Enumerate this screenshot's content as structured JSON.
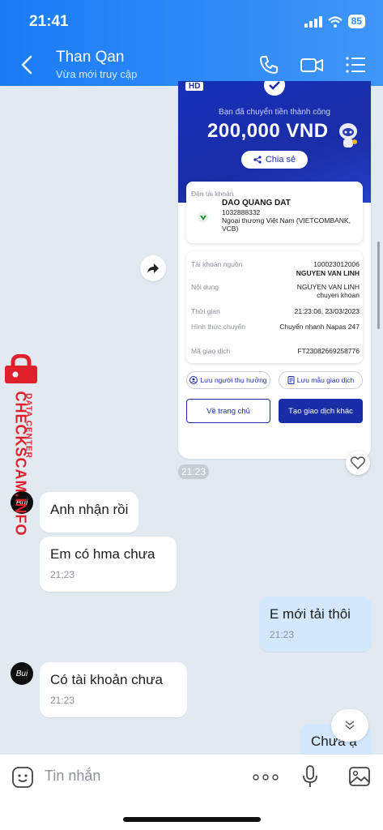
{
  "status": {
    "time": "21:41",
    "battery": "85"
  },
  "header": {
    "name": "Than Qan",
    "subtitle": "Vừa mới truy cập"
  },
  "receipt": {
    "badge": "HD",
    "success_text": "Bạn đã chuyển tiền thành công",
    "amount": "200,000 VND",
    "share": "Chia sẻ",
    "to_label": "Đến tài khoản",
    "to_name": "DAO QUANG DAT",
    "to_number": "1032888332",
    "to_bank": "Ngoại thương Việt Nam (VIETCOMBANK, VCB)",
    "rows": [
      {
        "k": "Tài khoản nguồn",
        "v": "100023012006",
        "v2": "NGUYEN VAN LINH"
      },
      {
        "k": "Nội dung",
        "v": "NGUYEN VAN LINH chuyen khoan"
      },
      {
        "k": "Thời gian",
        "v": "21:23:06, 23/03/2023"
      },
      {
        "k": "Hình thức chuyển",
        "v": "Chuyển nhanh Napas 247"
      },
      {
        "k": "Mã giao dịch",
        "v": "FT23082669258776"
      }
    ],
    "save_recipient": "Lưu người thụ hưởng",
    "save_template": "Lưu mẫu giao dịch",
    "home_btn": "Về trang chủ",
    "new_btn": "Tạo giao dịch khác"
  },
  "card_time": "21:23",
  "messages": [
    {
      "text": "Anh nhận rồi"
    },
    {
      "text": "Em có hma chưa",
      "time": "21:23"
    },
    {
      "text": "E mới tải thôi",
      "time": "21:23"
    },
    {
      "text": "Có tài khoản chưa",
      "time": "21:23"
    },
    {
      "text": "Chưa ạ"
    }
  ],
  "watermark": {
    "main": "CHECKSCAM.INFO",
    "sub": "DATA CENTER"
  },
  "composer": {
    "placeholder": "Tin nhắn"
  },
  "colors": {
    "header": "#1a7bf5",
    "bank_blue": "#1b2da6",
    "my_bubble": "#d3e8fd",
    "watermark": "#e0212b"
  }
}
